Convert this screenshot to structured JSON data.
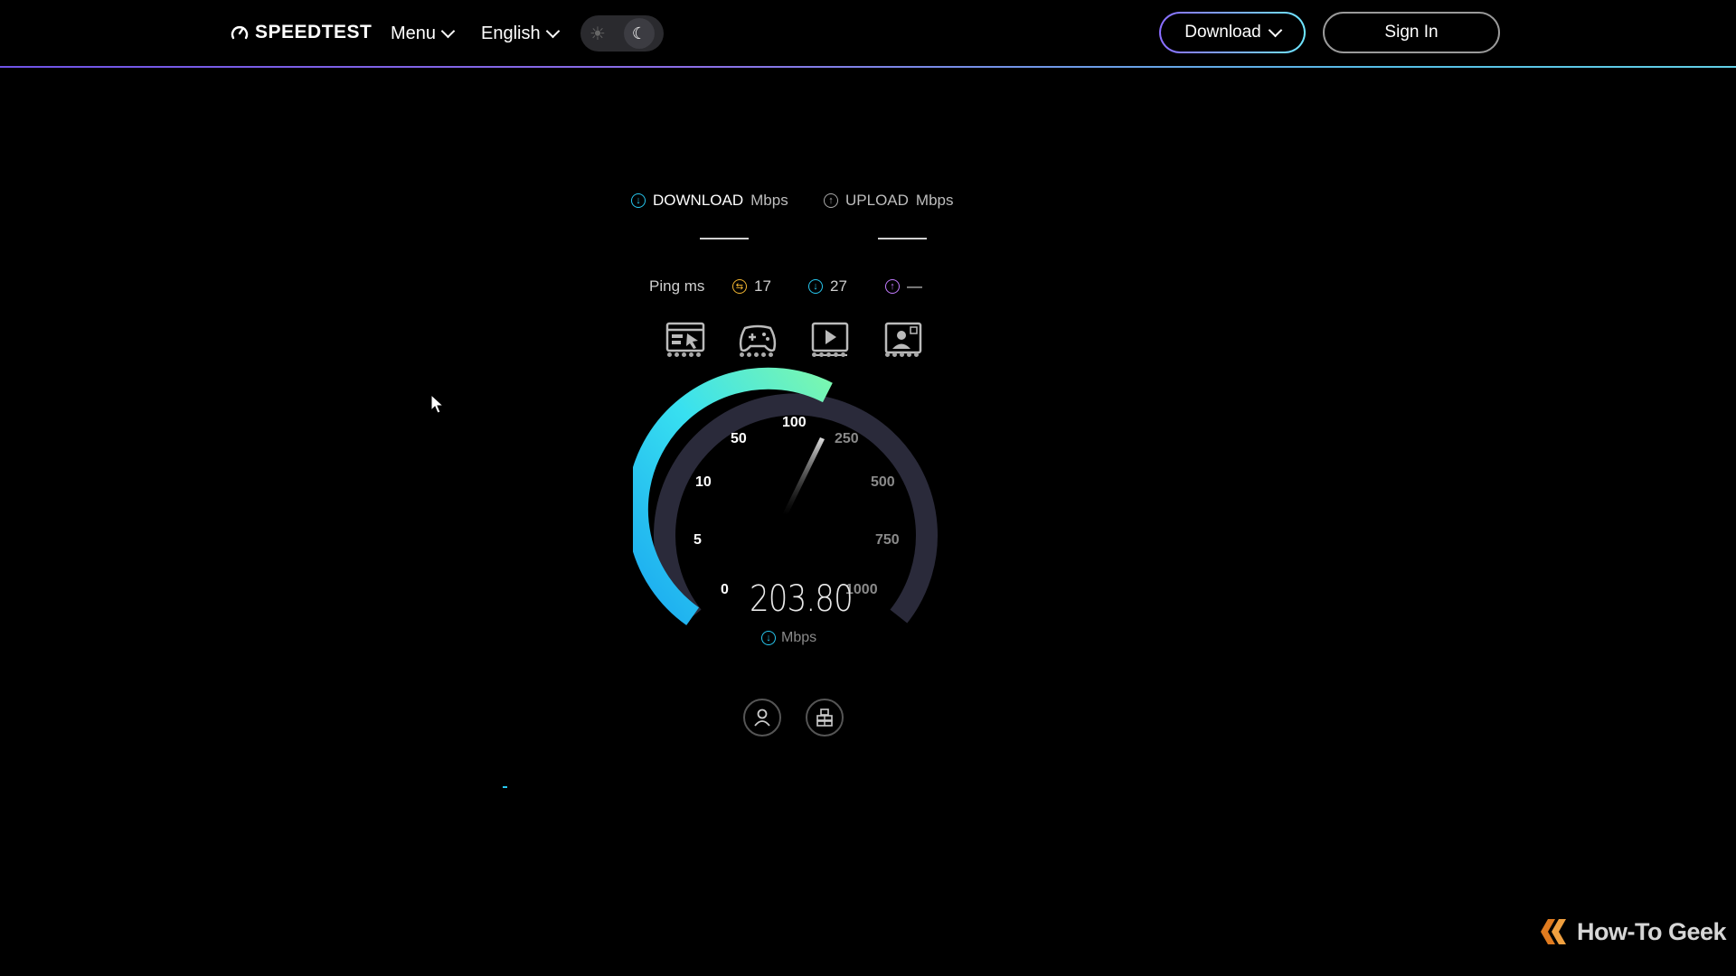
{
  "header": {
    "brand": "SPEEDTEST",
    "menu_label": "Menu",
    "language_label": "English",
    "download_button": "Download",
    "signin_button": "Sign In"
  },
  "metrics": {
    "download_label": "DOWNLOAD",
    "download_unit": "Mbps",
    "upload_label": "UPLOAD",
    "upload_unit": "Mbps"
  },
  "ping": {
    "label": "Ping ms",
    "idle": "17",
    "download": "27",
    "upload": "—"
  },
  "gauge": {
    "labels": [
      "0",
      "5",
      "10",
      "50",
      "100",
      "250",
      "500",
      "750",
      "1000"
    ],
    "speed": "203.80",
    "unit": "Mbps"
  },
  "watermark": "How-To Geek",
  "colors": {
    "accent_cyan": "#27c7ef",
    "accent_green": "#6ef5b2",
    "accent_purple": "#9b7bff",
    "ping_idle": "#f2b530",
    "ping_up": "#c27bff"
  }
}
